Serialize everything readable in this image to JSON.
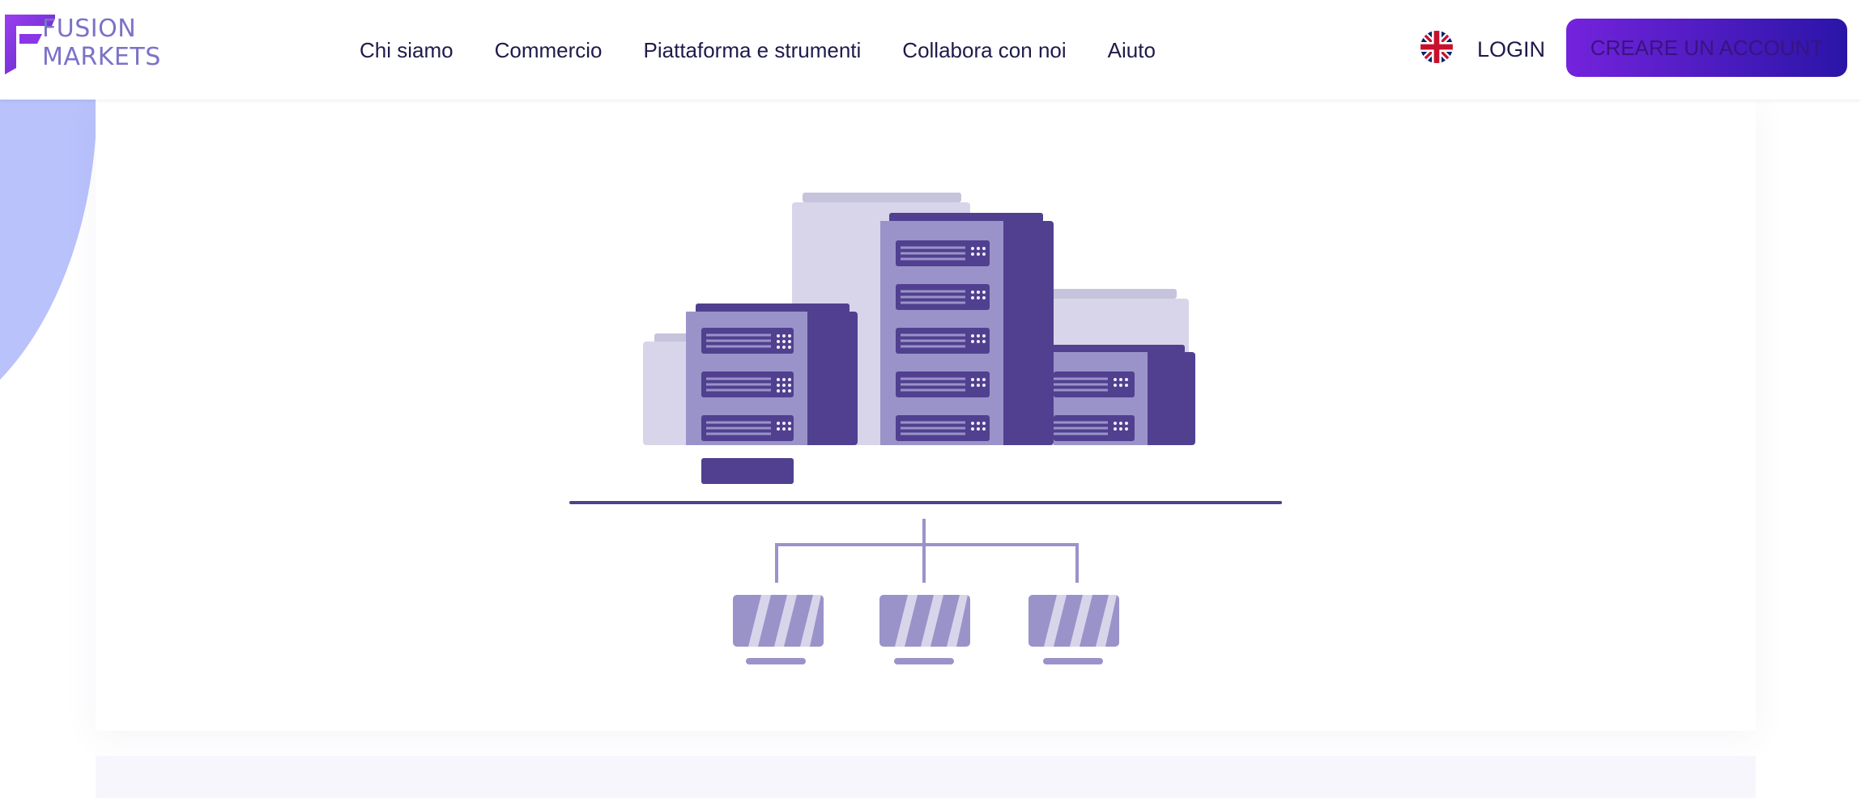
{
  "header": {
    "logo": {
      "line1": "FUSION",
      "line2": "MARKETS"
    },
    "nav": [
      "Chi siamo",
      "Commercio",
      "Piattaforma e strumenti",
      "Collabora con noi",
      "Aiuto"
    ],
    "language_icon": "uk-flag-icon",
    "login_label": "LOGIN",
    "cta_label": "CREARE UN ACCOUNT"
  },
  "colors": {
    "brand_purple": "#7423dc",
    "brand_blue": "#2a15a8",
    "server_dark": "#50408f",
    "server_mid": "#9a93c9",
    "server_light": "#d8d5ea",
    "blob": "#b9c2fb"
  },
  "illustration": {
    "subject": "server-network-icon",
    "servers": 3,
    "clients": 3
  }
}
